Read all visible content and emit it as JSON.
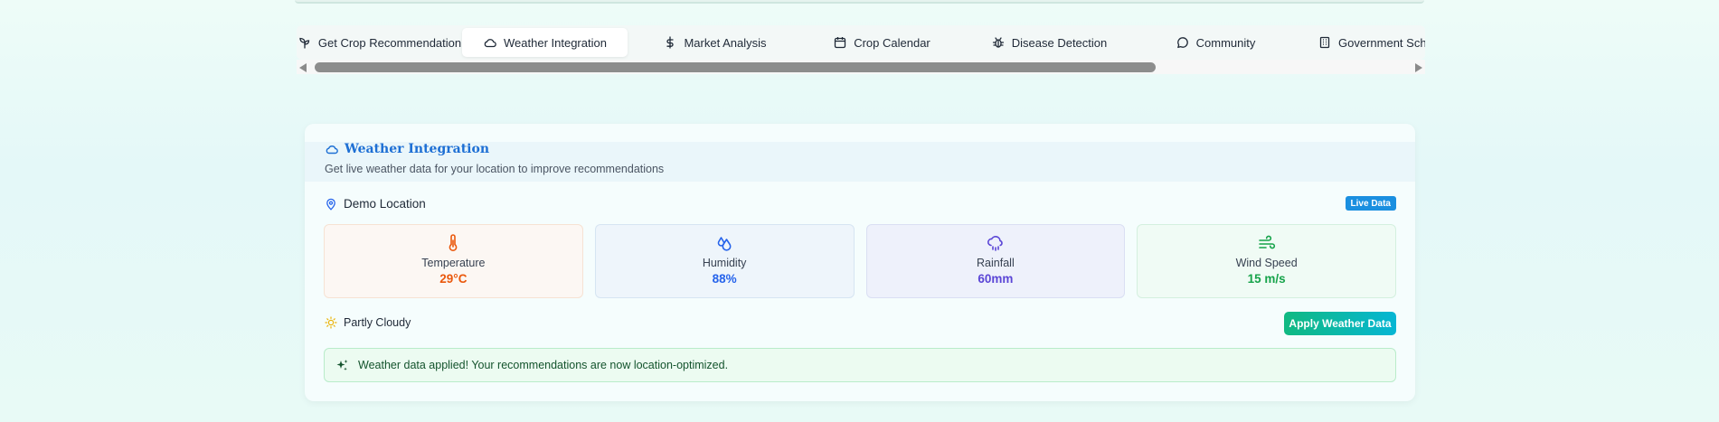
{
  "nav": {
    "tabs": [
      {
        "label": "Get Crop Recommendation",
        "icon": "sprout-icon"
      },
      {
        "label": "Weather Integration",
        "icon": "cloud-icon",
        "active": true
      },
      {
        "label": "Market Analysis",
        "icon": "dollar-icon"
      },
      {
        "label": "Crop Calendar",
        "icon": "calendar-icon"
      },
      {
        "label": "Disease Detection",
        "icon": "bug-icon"
      },
      {
        "label": "Community",
        "icon": "chat-bubble-icon"
      },
      {
        "label": "Government Schem",
        "icon": "building-icon"
      }
    ]
  },
  "weather": {
    "title": "Weather Integration",
    "subtitle": "Get live weather data for your location to improve recommendations",
    "location": "Demo Location",
    "badge": "Live Data",
    "metrics": {
      "temperature": {
        "label": "Temperature",
        "value": "29°C"
      },
      "humidity": {
        "label": "Humidity",
        "value": "88%"
      },
      "rainfall": {
        "label": "Rainfall",
        "value": "60mm"
      },
      "wind": {
        "label": "Wind Speed",
        "value": "15 m/s"
      }
    },
    "condition": "Partly Cloudy",
    "apply_label": "Apply Weather Data",
    "notice": "Weather data applied! Your recommendations are now location-optimized."
  },
  "colors": {
    "accent_blue": "#1d6fd4",
    "temperature": "#ea580c",
    "humidity": "#2563eb",
    "rainfall": "#5b46d6",
    "wind": "#16a34a",
    "button_gradient_start": "#10b981",
    "button_gradient_end": "#06b6d4"
  }
}
